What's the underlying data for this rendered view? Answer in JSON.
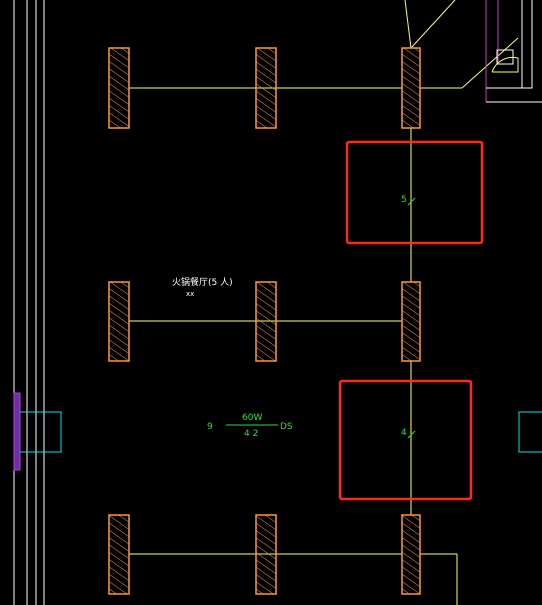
{
  "colors": {
    "background": "#000000",
    "wall": "#ffffff",
    "structure": "#ffff66",
    "fixture": "#ff9933",
    "selection": "#ff2a1a",
    "annotation": "#33dd33",
    "cyan": "#00e5ee",
    "magenta": "#cc33cc"
  },
  "labels": {
    "room_name": "火锅餐厅(5 人)",
    "room_sub": "xx",
    "circuit_id": "9",
    "lamp_power": "60W",
    "lamp_count": "4 2",
    "lamp_type": "DS",
    "box_upper_num": "5",
    "box_lower_num": "4"
  },
  "icons": {
    "hatched_fixture": "hatched-fixture-icon",
    "door_arc": "door-swing-icon",
    "tick_mark": "tick-mark-icon"
  }
}
